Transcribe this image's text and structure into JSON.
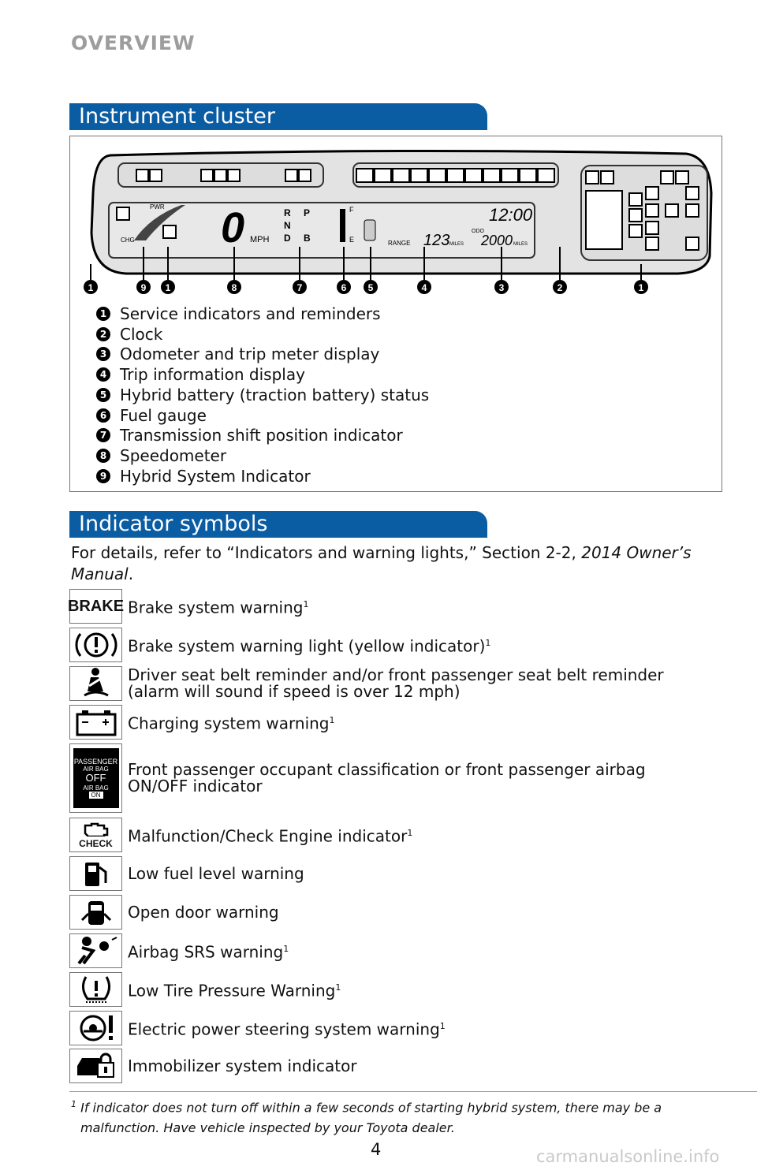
{
  "header": "OVERVIEW",
  "cluster": {
    "title": "Instrument cluster",
    "display": {
      "pwr": "PWR",
      "chg": "CHG",
      "speed": "0",
      "mph": "MPH",
      "gears": [
        "R",
        "N",
        "D"
      ],
      "gears2": [
        "P",
        "B"
      ],
      "full": "F",
      "empty": "E",
      "range": "RANGE",
      "range_val": "123",
      "miles": "MILES",
      "odo": "ODO",
      "odo_val": "2000",
      "clock": "12:00"
    },
    "callouts": [
      "1",
      "9",
      "1",
      "8",
      "7",
      "6",
      "5",
      "4",
      "3",
      "2",
      "1"
    ],
    "legend": [
      {
        "n": "1",
        "text": "Service indicators and reminders"
      },
      {
        "n": "2",
        "text": "Clock"
      },
      {
        "n": "3",
        "text": "Odometer and trip meter display"
      },
      {
        "n": "4",
        "text": "Trip information display"
      },
      {
        "n": "5",
        "text": "Hybrid battery (traction battery) status"
      },
      {
        "n": "6",
        "text": "Fuel gauge"
      },
      {
        "n": "7",
        "text": "Transmission shift position indicator"
      },
      {
        "n": "8",
        "text": "Speedometer"
      },
      {
        "n": "9",
        "text": "Hybrid System Indicator"
      }
    ]
  },
  "indicators": {
    "title": "Indicator symbols",
    "intro": "For details, refer to “Indicators and warning lights,” Section 2-2, ",
    "intro_italic": "2014 Owner’s Manual",
    "intro_end": ".",
    "items": [
      {
        "icon": "brake-text-icon",
        "icon_text": "BRAKE",
        "text": "Brake system warning",
        "sup": "1"
      },
      {
        "icon": "brake-warning-circle-icon",
        "text": "Brake system warning light (yellow indicator)",
        "sup": "1"
      },
      {
        "icon": "seat-belt-icon",
        "text": "Driver seat belt reminder and/or front passenger seat belt reminder",
        "text2": "(alarm will sound if speed is over 12 mph)"
      },
      {
        "icon": "battery-icon",
        "text": "Charging system warning",
        "sup": "1"
      },
      {
        "icon": "passenger-airbag-icon",
        "icon_lines": [
          "PASSENGER",
          "AIR BAG",
          "OFF",
          "AIR BAG",
          "ON"
        ],
        "text": "Front passenger occupant classification or front passenger airbag",
        "text2": "ON/OFF indicator"
      },
      {
        "icon": "check-engine-icon",
        "icon_text": "CHECK",
        "text": "Malfunction/Check Engine indicator",
        "sup": "1"
      },
      {
        "icon": "fuel-pump-icon",
        "text": "Low fuel level warning"
      },
      {
        "icon": "open-door-icon",
        "text": "Open door warning"
      },
      {
        "icon": "airbag-srs-icon",
        "text": "Airbag SRS warning",
        "sup": "1"
      },
      {
        "icon": "tire-pressure-icon",
        "text": "Low Tire Pressure Warning",
        "sup": "1"
      },
      {
        "icon": "power-steering-icon",
        "text": "Electric power steering system warning",
        "sup": "1"
      },
      {
        "icon": "immobilizer-icon",
        "text": "Immobilizer system indicator"
      }
    ]
  },
  "footnote": {
    "mark": "1",
    "text": "If indicator does not turn off within a few seconds of starting hybrid system, there may be a",
    "text2": "malfunction. Have vehicle inspected by your Toyota dealer."
  },
  "page_number": "4",
  "watermark": "carmanualsonline.info",
  "colors": {
    "banner": "#0a5ca3",
    "header": "#9d9d9d"
  }
}
